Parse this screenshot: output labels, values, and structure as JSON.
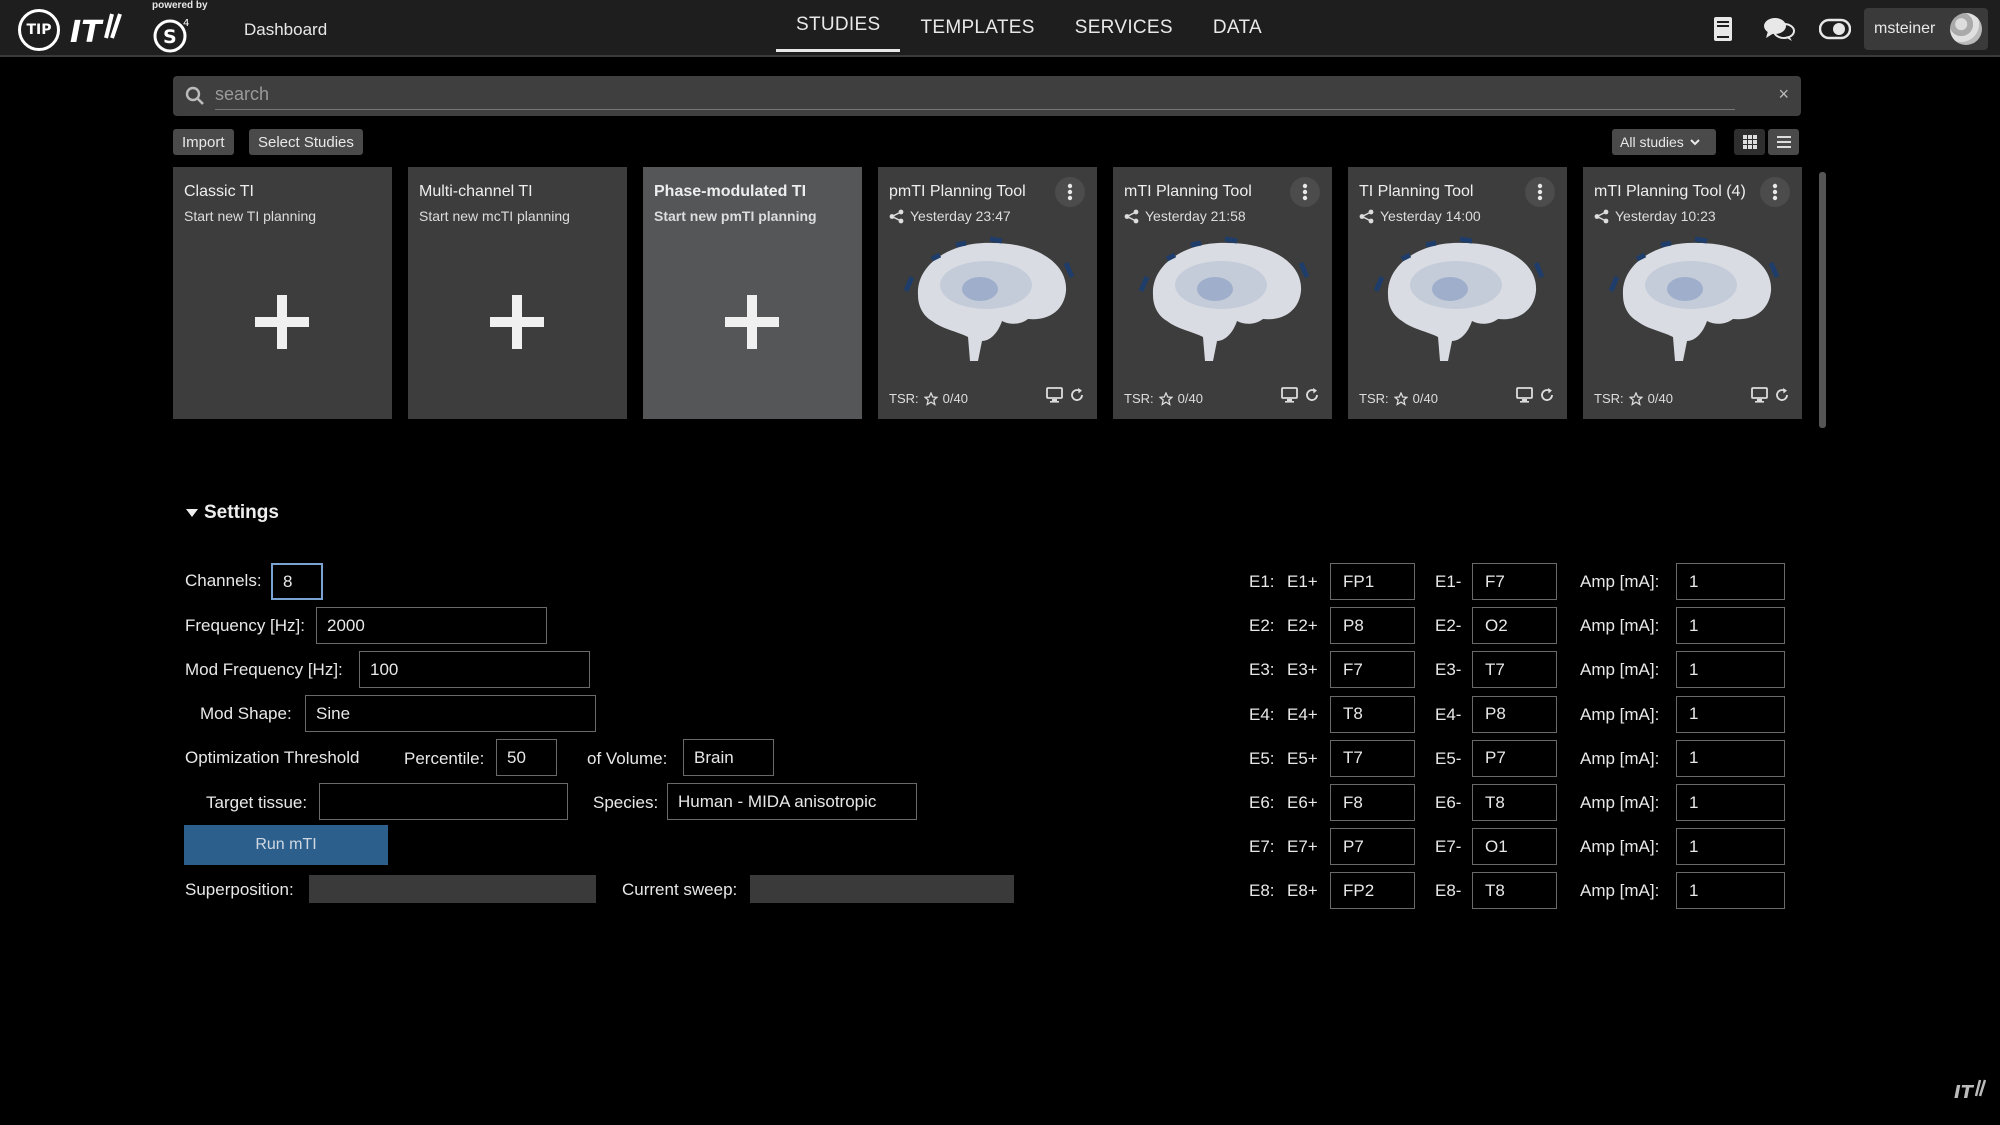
{
  "header": {
    "powered_by": "powered by",
    "s4l_mark": "S",
    "s4l_sup": "4",
    "dashboard": "Dashboard",
    "nav": [
      "STUDIES",
      "TEMPLATES",
      "SERVICES",
      "DATA"
    ],
    "active_nav": "STUDIES",
    "username": "msteiner",
    "logo_tip": "TIP"
  },
  "search": {
    "placeholder": "search",
    "clear": "×"
  },
  "toolbar": {
    "import": "Import",
    "select_studies": "Select Studies",
    "filter": "All studies"
  },
  "templates": [
    {
      "title": "Classic TI",
      "subtitle": "Start new TI planning"
    },
    {
      "title": "Multi-channel TI",
      "subtitle": "Start new mcTI planning"
    },
    {
      "title": "Phase-modulated TI",
      "subtitle": "Start new pmTI planning"
    }
  ],
  "studies": [
    {
      "title": "pmTI Planning Tool",
      "date": "Yesterday 23:47",
      "tsr_label": "TSR:",
      "tsr_value": "0/40"
    },
    {
      "title": "mTI Planning Tool",
      "date": "Yesterday 21:58",
      "tsr_label": "TSR:",
      "tsr_value": "0/40"
    },
    {
      "title": "TI Planning Tool",
      "date": "Yesterday 14:00",
      "tsr_label": "TSR:",
      "tsr_value": "0/40"
    },
    {
      "title": "mTI Planning Tool (4)",
      "date": "Yesterday 10:23",
      "tsr_label": "TSR:",
      "tsr_value": "0/40"
    }
  ],
  "settings": {
    "heading": "Settings",
    "channels_label": "Channels:",
    "channels": "8",
    "frequency_label": "Frequency [Hz]:",
    "frequency": "2000",
    "mod_frequency_label": "Mod Frequency [Hz]:",
    "mod_frequency": "100",
    "mod_shape_label": "Mod Shape:",
    "mod_shape": "Sine",
    "opt_threshold_label": "Optimization Threshold",
    "percentile_label": "Percentile:",
    "percentile": "50",
    "of_volume_label": "of Volume:",
    "of_volume": "Brain",
    "target_tissue_label": "Target tissue:",
    "target_tissue": "",
    "species_label": "Species:",
    "species": "Human - MIDA anisotropic",
    "run_button": "Run mTI",
    "superposition_label": "Superposition:",
    "current_sweep_label": "Current sweep:"
  },
  "electrodes": [
    {
      "e": "E1:",
      "plus_label": "E1+",
      "plus": "FP1",
      "minus_label": "E1-",
      "minus": "F7",
      "amp_label": "Amp [mA]:",
      "amp": "1"
    },
    {
      "e": "E2:",
      "plus_label": "E2+",
      "plus": "P8",
      "minus_label": "E2-",
      "minus": "O2",
      "amp_label": "Amp [mA]:",
      "amp": "1"
    },
    {
      "e": "E3:",
      "plus_label": "E3+",
      "plus": "F7",
      "minus_label": "E3-",
      "minus": "T7",
      "amp_label": "Amp [mA]:",
      "amp": "1"
    },
    {
      "e": "E4:",
      "plus_label": "E4+",
      "plus": "T8",
      "minus_label": "E4-",
      "minus": "P8",
      "amp_label": "Amp [mA]:",
      "amp": "1"
    },
    {
      "e": "E5:",
      "plus_label": "E5+",
      "plus": "T7",
      "minus_label": "E5-",
      "minus": "P7",
      "amp_label": "Amp [mA]:",
      "amp": "1"
    },
    {
      "e": "E6:",
      "plus_label": "E6+",
      "plus": "F8",
      "minus_label": "E6-",
      "minus": "T8",
      "amp_label": "Amp [mA]:",
      "amp": "1"
    },
    {
      "e": "E7:",
      "plus_label": "E7+",
      "plus": "P7",
      "minus_label": "E7-",
      "minus": "O1",
      "amp_label": "Amp [mA]:",
      "amp": "1"
    },
    {
      "e": "E8:",
      "plus_label": "E8+",
      "plus": "FP2",
      "minus_label": "E8-",
      "minus": "T8",
      "amp_label": "Amp [mA]:",
      "amp": "1"
    }
  ],
  "colors": {
    "run_button": "#2d5f8c",
    "card": "#3d3d3d",
    "card_highlight": "#555658",
    "topbar": "#1e1e1e"
  }
}
